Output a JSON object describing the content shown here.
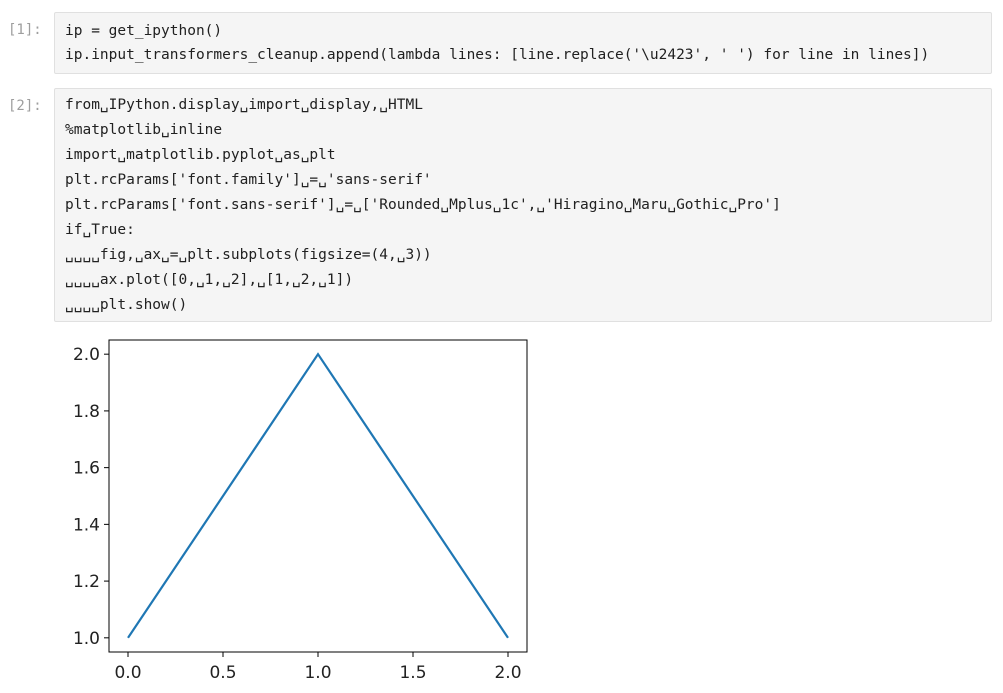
{
  "cells": [
    {
      "prompt": "[1]:",
      "lines": [
        "ip = get_ipython()",
        "ip.input_transformers_cleanup.append(lambda lines: [line.replace('\\u2423', ' ') for line in lines])"
      ]
    },
    {
      "prompt": "[2]:",
      "lines": [
        "from␣IPython.display␣import␣display,␣HTML",
        "%matplotlib␣inline",
        "import␣matplotlib.pyplot␣as␣plt",
        "plt.rcParams['font.family']␣=␣'sans-serif'",
        "plt.rcParams['font.sans-serif']␣=␣['Rounded␣Mplus␣1c',␣'Hiragino␣Maru␣Gothic␣Pro']",
        "if␣True:",
        "␣␣␣␣fig,␣ax␣=␣plt.subplots(figsize=(4,␣3))",
        "␣␣␣␣ax.plot([0,␣1,␣2],␣[1,␣2,␣1])",
        "␣␣␣␣plt.show()"
      ]
    }
  ],
  "chart_data": {
    "type": "line",
    "x": [
      0,
      1,
      2
    ],
    "series": [
      {
        "values": [
          1,
          2,
          1
        ],
        "color": "#1f77b4"
      }
    ],
    "xlim": [
      -0.1,
      2.1
    ],
    "ylim": [
      0.95,
      2.05
    ],
    "xticks": [
      0.0,
      0.5,
      1.0,
      1.5,
      2.0
    ],
    "xtick_labels": [
      "0.0",
      "0.5",
      "1.0",
      "1.5",
      "2.0"
    ],
    "yticks": [
      1.0,
      1.2,
      1.4,
      1.6,
      1.8,
      2.0
    ],
    "ytick_labels": [
      "1.0",
      "1.2",
      "1.4",
      "1.6",
      "1.8",
      "2.0"
    ],
    "grid": false,
    "title": "",
    "xlabel": "",
    "ylabel": ""
  }
}
